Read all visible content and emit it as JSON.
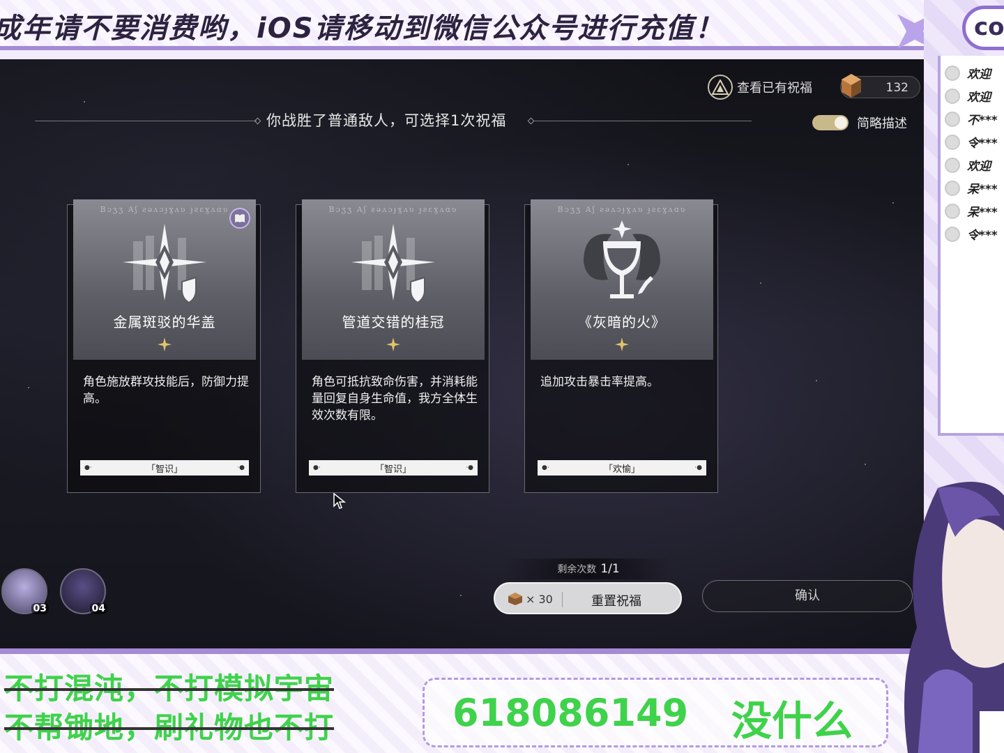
{
  "overlay": {
    "top_banner": "成年请不要消费哟，iOS请移动到微信公众号进行充值！",
    "logo_text": "co",
    "chat": [
      {
        "text": "欢迎"
      },
      {
        "text": "欢迎"
      },
      {
        "text": "不***"
      },
      {
        "text": "令***"
      },
      {
        "text": "欢迎"
      },
      {
        "text": "呆***"
      },
      {
        "text": "呆***"
      },
      {
        "text": "令***"
      }
    ],
    "bottom_left_line1": "不打混沌，不打模拟宇宙",
    "bottom_left_line2": "不帮锄地，刷礼物也不打",
    "bottom_number": "618086149",
    "bottom_message": "没什么"
  },
  "game": {
    "view_blessings_label": "查看已有祝福",
    "currency_amount": "132",
    "title": "你战胜了普通敌人，可选择1次祝福",
    "toggle_label": "简略描述",
    "toggle_on": true,
    "cards": [
      {
        "rune": "Bɔʒʒ Aʃ ƨəʌɔɟɣʌʋ ɟƨɛɣʌɑʋ",
        "name": "金属斑驳的华盖",
        "description": "角色施放群攻技能后，防御力提高。",
        "path": "「智识」",
        "has_badge": true,
        "emblem": "shield-compass-icon"
      },
      {
        "rune": "Bɔʒʒ Aʃ ƨəʌɔɟɣʌʋ ɟƨɛɣʌɑʋ",
        "name": "管道交错的桂冠",
        "description": "角色可抵抗致命伤害，并消耗能量回复自身生命值，我方全体生效次数有限。",
        "path": "「智识」",
        "has_badge": false,
        "emblem": "shield-compass-icon"
      },
      {
        "rune": "Bɔʒʒ Aʃ ƨəʌɔɟɣʌʋ ɟƨɛɣʌɑʋ",
        "name": "《灰暗的火》",
        "description": "追加攻击暴击率提高。",
        "path": "「欢愉」",
        "has_badge": false,
        "emblem": "goblet-sword-icon"
      }
    ],
    "party": [
      {
        "level": "03"
      },
      {
        "level": "04"
      }
    ],
    "remaining_label": "剩余次数",
    "remaining_value": "1/1",
    "reset_cost": "× 30",
    "reset_label": "重置祝福",
    "confirm_label": "确认"
  },
  "colors": {
    "overlay_accent": "#a58ad6",
    "green_text": "#3fd24b",
    "gold_star": "#e3c46a"
  }
}
